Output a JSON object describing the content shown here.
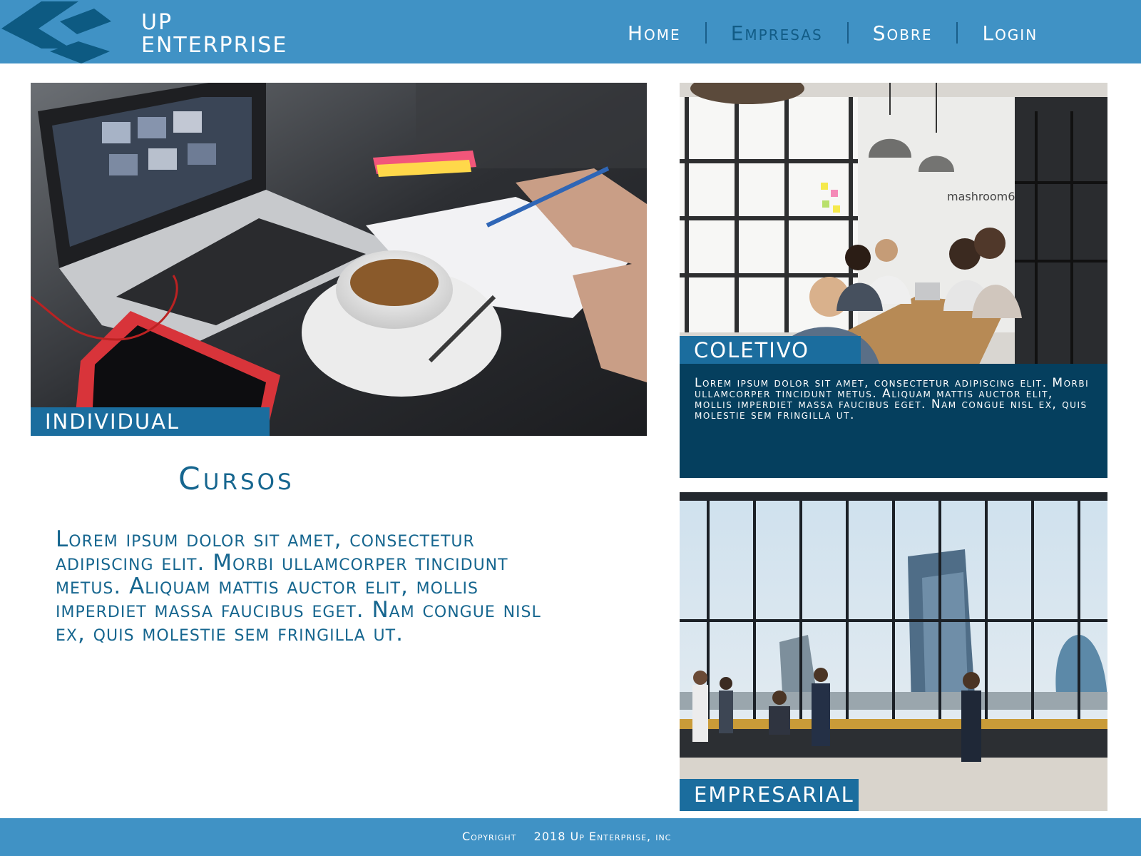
{
  "brand": {
    "line1": "UP",
    "line2": "ENTERPRISE"
  },
  "nav": {
    "home": "Home",
    "empresas": "Empresas",
    "sobre": "Sobre",
    "login": "Login",
    "active": "Empresas"
  },
  "cards": {
    "individual": "INDIVIDUAL",
    "coletivo": "COLETIVO",
    "empresarial": "EMPRESARIAL"
  },
  "coletivo_text": "Lorem ipsum dolor sit amet, consectetur adipiscing elit. Morbi ullamcorper tincidunt metus. Aliquam mattis auctor elit, mollis imperdiet massa faucibus eget. Nam congue nisl ex, quis molestie sem fringilla ut.",
  "cursos": {
    "title": "Cursos",
    "text": "Lorem ipsum dolor sit amet, consectetur adipiscing elit. Morbi ullamcorper tincidunt metus. Aliquam mattis auctor elit, mollis imperdiet massa faucibus eget. Nam congue nisl ex, quis molestie sem fringilla ut."
  },
  "photo_sign": "mashroom6",
  "footer": {
    "copyright": "Copyright    2018 Up Enterprise, inc"
  },
  "colors": {
    "header": "#4092c5",
    "accent": "#16668f",
    "tag": "#1b6d9e",
    "dark_box": "#053f5e",
    "logo": "#0d5a82"
  }
}
